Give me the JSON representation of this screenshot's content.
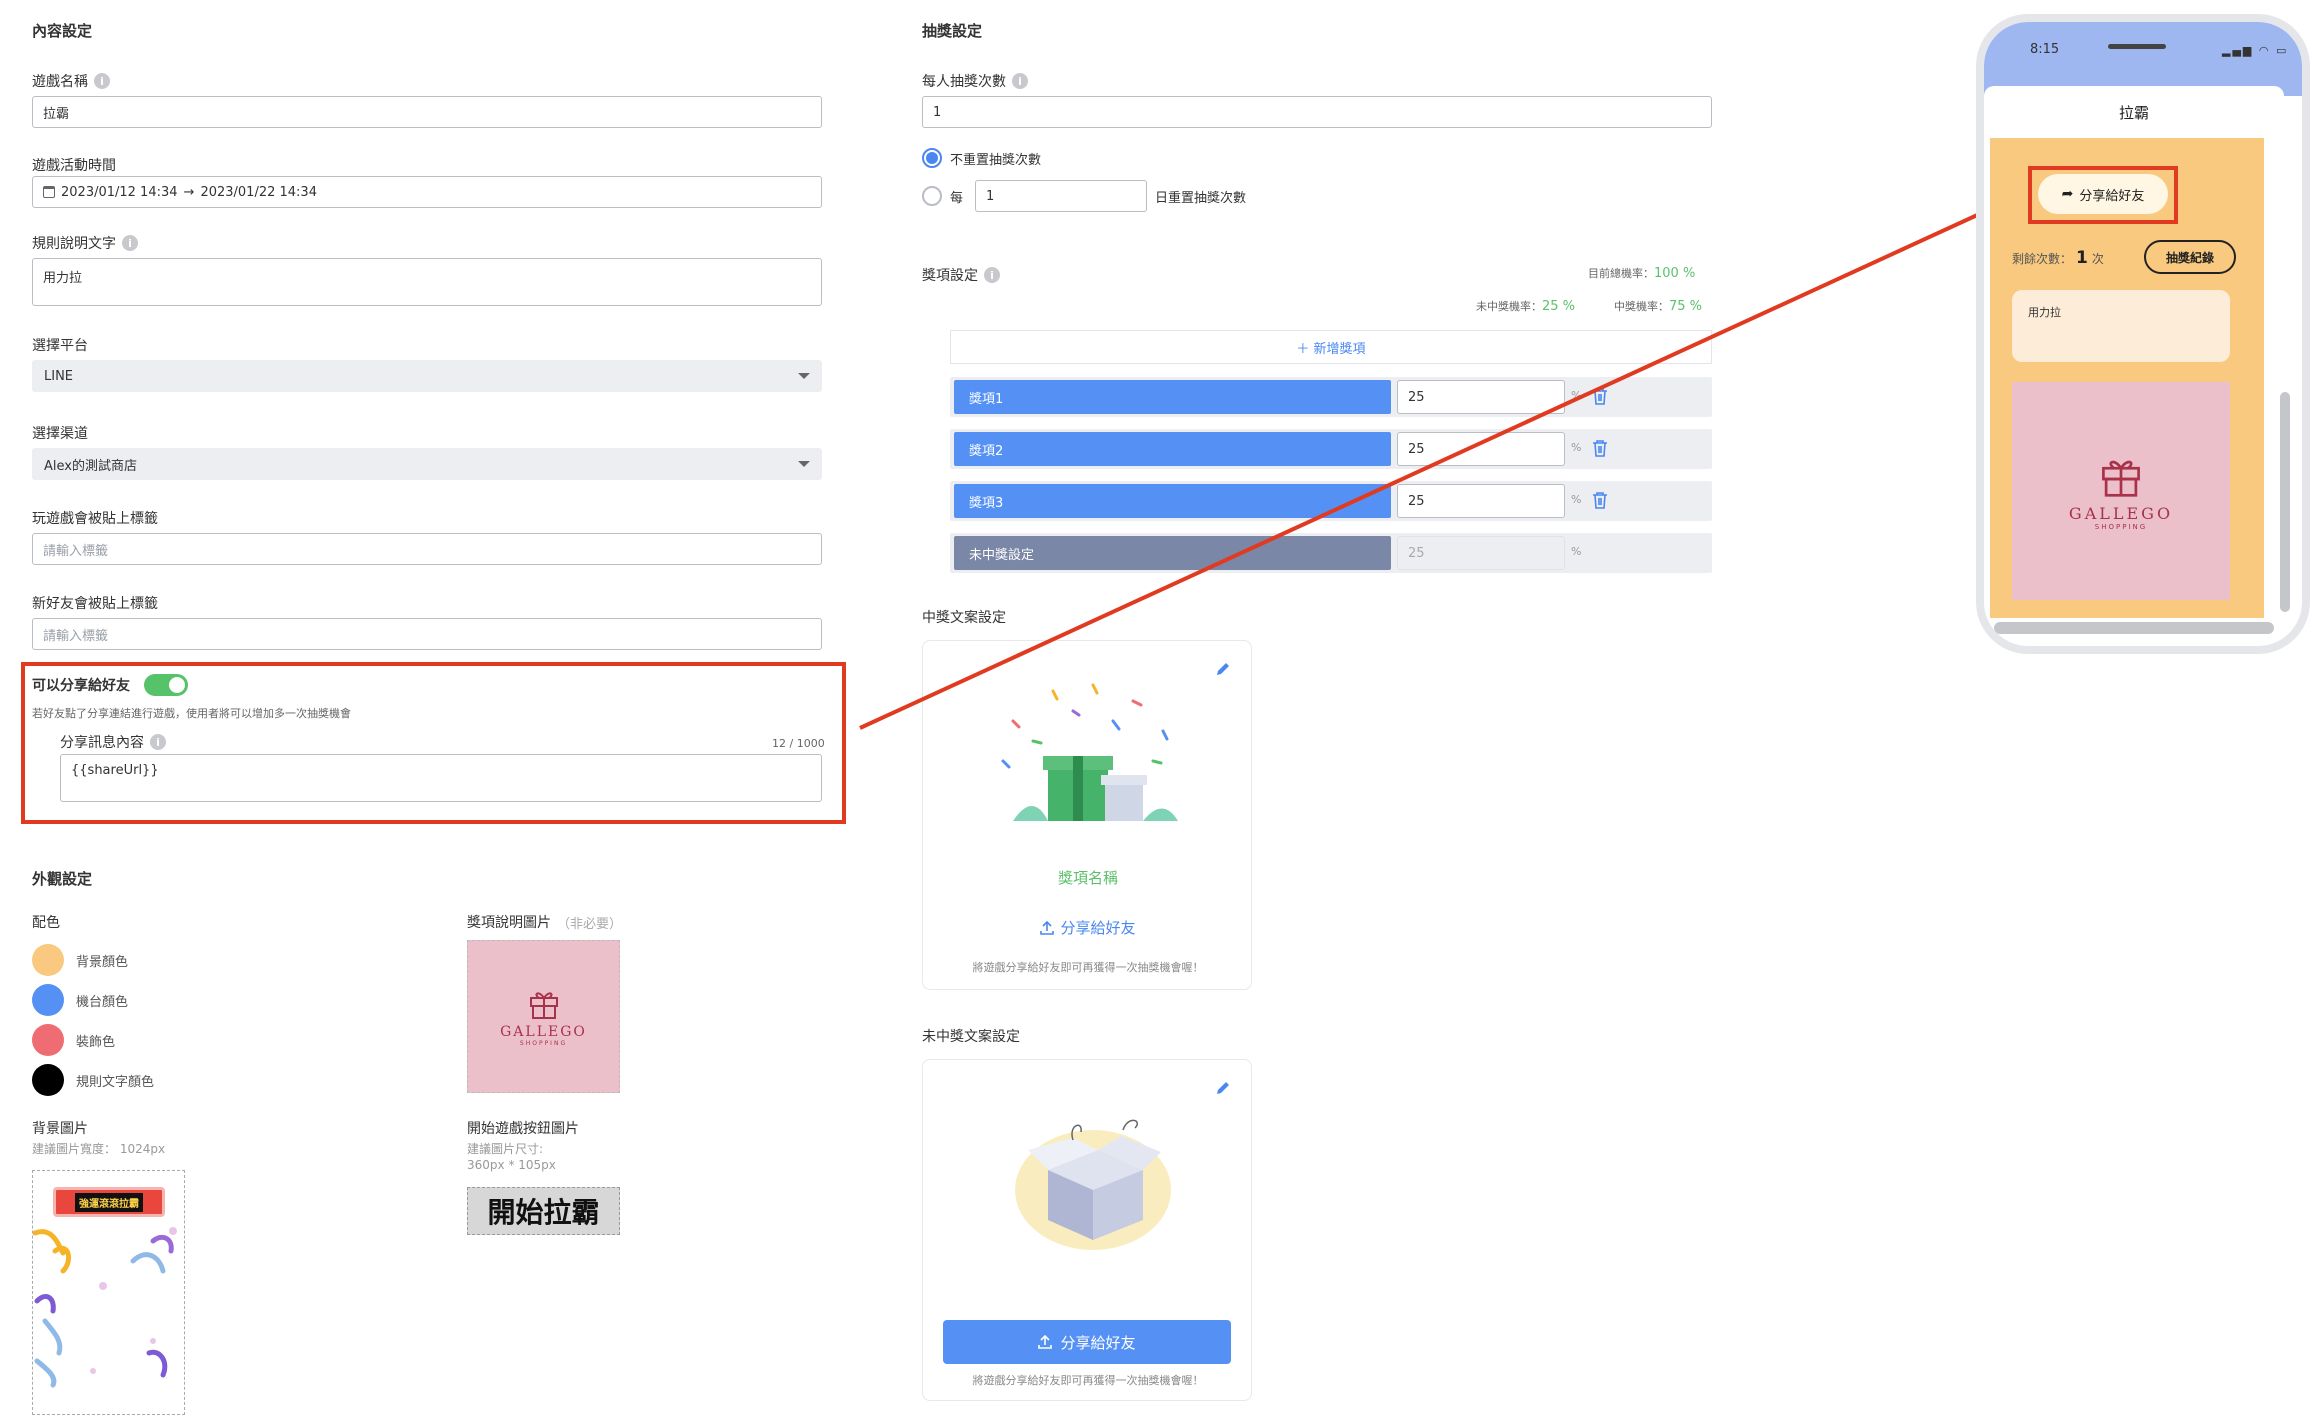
{
  "content": {
    "title": "內容設定",
    "game_name": {
      "label": "遊戲名稱",
      "value": "拉霸"
    },
    "active_time": {
      "label": "遊戲活動時間",
      "start": "2023/01/12 14:34",
      "arrow": "→",
      "end": "2023/01/22 14:34"
    },
    "rules": {
      "label": "規則說明文字",
      "value": "用力拉"
    },
    "platform": {
      "label": "選擇平台",
      "value": "LINE"
    },
    "channel": {
      "label": "選擇渠道",
      "value": "Alex的測試商店"
    },
    "play_tag": {
      "label": "玩遊戲會被貼上標籤",
      "placeholder": "請輸入標籤"
    },
    "friend_tag": {
      "label": "新好友會被貼上標籤",
      "placeholder": "請輸入標籤"
    },
    "share": {
      "label": "可以分享給好友",
      "enabled": true,
      "note": "若好友點了分享連結進行遊戲，使用者將可以增加多一次抽獎機會",
      "msg_label": "分享訊息內容",
      "counter": "12 / 1000",
      "msg_value": "{{shareUrl}}"
    }
  },
  "appearance": {
    "title": "外觀設定",
    "color_label": "配色",
    "colors": [
      {
        "label": "背景顏色",
        "hex": "#f8c97e"
      },
      {
        "label": "機台顏色",
        "hex": "#5591f5"
      },
      {
        "label": "裝飾色",
        "hex": "#ef6c73"
      },
      {
        "label": "規則文字顏色",
        "hex": "#000000"
      }
    ],
    "prize_image": {
      "label": "獎項說明圖片",
      "optional": "（非必要）",
      "brand": "GALLEGO",
      "brand_sub": "SHOPPING"
    },
    "bg_image": {
      "label": "背景圖片",
      "hint": "建議圖片寬度： 1024px",
      "sign": "強運滾滾拉霸"
    },
    "start_button": {
      "label": "開始遊戲按鈕圖片",
      "hint1": "建議圖片尺寸:",
      "hint2": "360px * 105px",
      "text": "開始拉霸"
    }
  },
  "draw": {
    "title": "抽獎設定",
    "per_person": {
      "label": "每人抽獎次數",
      "value": "1"
    },
    "no_reset": "不重置抽獎次數",
    "every": "每",
    "days_value": "1",
    "reset_suffix": "日重置抽獎次數",
    "prize_label": "獎項設定",
    "total_rate_label": "目前總機率：",
    "total_rate": "100 %",
    "miss_rate_label": "未中獎機率：",
    "miss_rate": "25 %",
    "win_rate_label": "中獎機率：",
    "win_rate": "75 %",
    "add_prize": "＋  新增獎項",
    "prizes": [
      {
        "name": "獎項1",
        "value": "25"
      },
      {
        "name": "獎項2",
        "value": "25"
      },
      {
        "name": "獎項3",
        "value": "25"
      }
    ],
    "miss": {
      "name": "未中獎設定",
      "value": "25"
    },
    "pct_sign": "%",
    "win_copy": {
      "title": "中獎文案設定",
      "prize_name": "獎項名稱",
      "share_btn": "分享給好友",
      "note": "將遊戲分享給好友即可再獲得一次抽獎機會喔！"
    },
    "lose_copy": {
      "title": "未中獎文案設定",
      "share_btn": "分享給好友",
      "note": "將遊戲分享給好友即可再獲得一次抽獎機會喔！"
    }
  },
  "phone": {
    "time": "8:15",
    "title": "拉霸",
    "share_btn": "分享給好友",
    "remaining_label": "剩餘次數：",
    "remaining_value": "1",
    "remaining_unit": "次",
    "history_btn": "抽獎紀錄",
    "rules_text": "用力拉",
    "brand": "GALLEGO",
    "brand_sub": "SHOPPING"
  }
}
